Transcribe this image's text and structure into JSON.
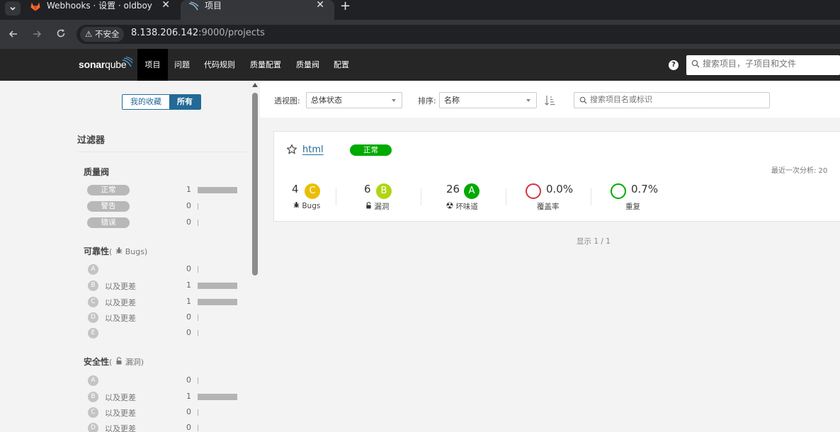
{
  "browser": {
    "tabs": [
      {
        "title": "Webhooks · 设置 · oldboy / g",
        "icon": "gitlab-icon"
      },
      {
        "title": "项目",
        "icon": "sonarqube-icon"
      }
    ],
    "tab_menu_icon": "chevron-down-icon",
    "tab_close": "✕",
    "new_tab": "+",
    "security_label": "不安全",
    "url_host": "8.138.206.142",
    "url_path": ":9000/projects"
  },
  "nav": {
    "logo_text": "sonar",
    "logo_text_bold": "qube",
    "items": [
      "项目",
      "问题",
      "代码规则",
      "质量配置",
      "质量阀",
      "配置"
    ],
    "search_placeholder": "搜索项目，子项目和文件",
    "help": "?"
  },
  "sidebar": {
    "toggle_favorites": "我的收藏",
    "toggle_all": "所有",
    "filter_title": "过滤器",
    "quality_gate": {
      "title": "质量阀",
      "rows": [
        {
          "label": "正常",
          "count": "1"
        },
        {
          "label": "警告",
          "count": "0"
        },
        {
          "label": "错误",
          "count": "0"
        }
      ]
    },
    "reliability": {
      "title": "可靠性",
      "paren_open": "(",
      "subtitle": "Bugs",
      "paren_close": ")",
      "rows": [
        {
          "grade": "A",
          "label": "",
          "count": "0"
        },
        {
          "grade": "B",
          "label": "以及更差",
          "count": "1"
        },
        {
          "grade": "C",
          "label": "以及更差",
          "count": "1"
        },
        {
          "grade": "D",
          "label": "以及更差",
          "count": "0"
        },
        {
          "grade": "E",
          "label": "",
          "count": "0"
        }
      ]
    },
    "security": {
      "title": "安全性",
      "paren_open": "(",
      "subtitle": "漏洞",
      "paren_close": ")",
      "rows": [
        {
          "grade": "A",
          "label": "",
          "count": "0"
        },
        {
          "grade": "B",
          "label": "以及更差",
          "count": "1"
        },
        {
          "grade": "C",
          "label": "以及更差",
          "count": "0"
        },
        {
          "grade": "D",
          "label": "以及更差",
          "count": "0"
        }
      ]
    }
  },
  "toolbar": {
    "perspective_label": "透视图:",
    "perspective_value": "总体状态",
    "sort_label": "排序:",
    "sort_value": "名称",
    "search_placeholder": "搜索项目名或标识"
  },
  "project": {
    "name": "html",
    "status": "正常",
    "last_analysis": "最近一次分析: 20",
    "metrics": {
      "bugs": {
        "value": "4",
        "grade": "C",
        "label": "Bugs"
      },
      "vulnerabilities": {
        "value": "6",
        "grade": "B",
        "label": "漏洞"
      },
      "code_smells": {
        "value": "26",
        "grade": "A",
        "label": "坏味道"
      },
      "coverage": {
        "value": "0.0%",
        "label": "覆盖率"
      },
      "duplications": {
        "value": "0.7%",
        "label": "重复"
      }
    }
  },
  "footer": {
    "count_text": "显示 1 / 1"
  },
  "colors": {
    "grade_a": "#00aa00",
    "grade_b": "#b0d513",
    "grade_c": "#eabe06",
    "coverage_ring": "#d4333f",
    "duplication_ring": "#00aa00",
    "link": "#236a97"
  }
}
